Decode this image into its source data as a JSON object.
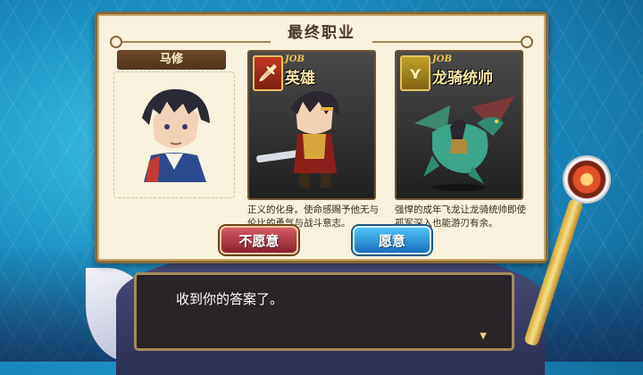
{
  "dialog": {
    "title": "最终职业",
    "character_name": "马修",
    "jobs": [
      {
        "tag": "JOB",
        "name": "英雄",
        "icon": "sword-icon",
        "description": "正义的化身。使命感赐予他无与伦比的勇气与战斗意志。"
      },
      {
        "tag": "JOB",
        "name": "龙骑统帅",
        "icon": "wing-icon",
        "description": "强悍的成年飞龙让龙骑统帅即使孤军深入也能游刃有余。"
      }
    ],
    "buttons": {
      "decline": "不愿意",
      "accept": "愿意"
    }
  },
  "message": {
    "text": "收到你的答案了。",
    "advance_icon": "triangle-down-icon"
  },
  "colors": {
    "decline_button": "#b23a48",
    "accept_button": "#2f9ee0",
    "panel_bg": "#f7f1de",
    "frame": "#8a6a3a"
  }
}
